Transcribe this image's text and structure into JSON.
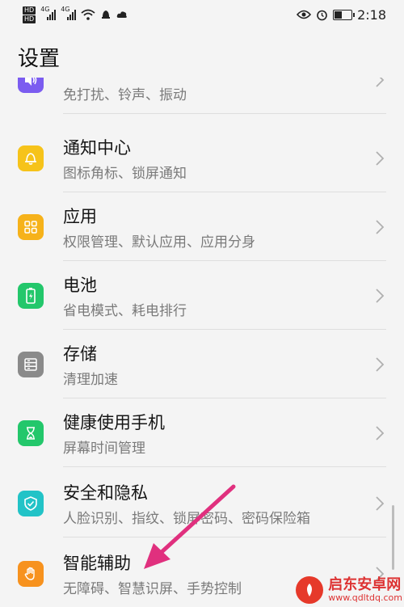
{
  "status_bar": {
    "hd_top": "HD",
    "hd_bottom": "HD",
    "network_1": "4G",
    "network_2": "4G",
    "time": "2:18"
  },
  "page_title": "设置",
  "rows": [
    {
      "label": "声音",
      "sub": "免打扰、铃声、振动",
      "icon": "speaker-icon",
      "color": "#7b5cf0"
    },
    {
      "label": "通知中心",
      "sub": "图标角标、锁屏通知",
      "icon": "bell-icon",
      "color": "#f6c31a"
    },
    {
      "label": "应用",
      "sub": "权限管理、默认应用、应用分身",
      "icon": "apps-grid-icon",
      "color": "#f6b21a"
    },
    {
      "label": "电池",
      "sub": "省电模式、耗电排行",
      "icon": "battery-icon",
      "color": "#23c76b"
    },
    {
      "label": "存储",
      "sub": "清理加速",
      "icon": "storage-icon",
      "color": "#8a8a8a"
    },
    {
      "label": "健康使用手机",
      "sub": "屏幕时间管理",
      "icon": "hourglass-icon",
      "color": "#23c76b"
    },
    {
      "label": "安全和隐私",
      "sub": "人脸识别、指纹、锁屏密码、密码保险箱",
      "icon": "shield-icon",
      "color": "#22c3c7"
    },
    {
      "label": "智能辅助",
      "sub": "无障碍、智慧识屏、手势控制",
      "icon": "hand-icon",
      "color": "#f7921e"
    }
  ],
  "watermark": {
    "name": "启东安卓网",
    "url": "www.qdltdq.com"
  },
  "colors": {
    "background": "#f4f4f4",
    "annotation_arrow": "#e0307e"
  }
}
